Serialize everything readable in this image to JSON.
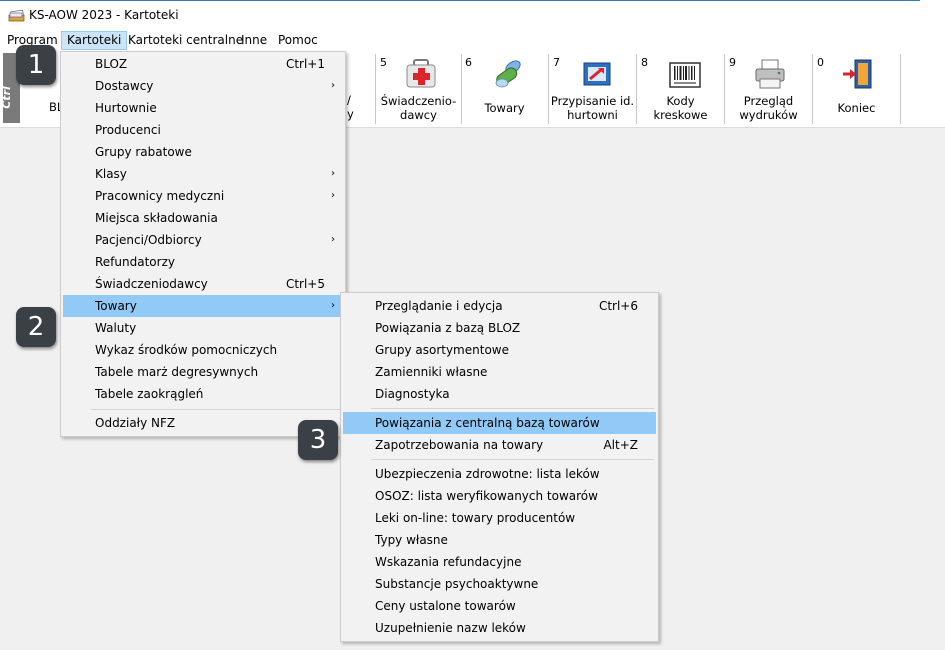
{
  "window": {
    "title": "KS-AOW 2023 - Kartoteki"
  },
  "menubar": {
    "items": [
      "Program",
      "Kartoteki",
      "Kartoteki centralne",
      "Inne",
      "Pomoc"
    ]
  },
  "toolbar": {
    "ctrl_label": "Ctrl",
    "partial_label_1": "BL",
    "partial_label_2": "/",
    "partial_label_3": "y",
    "buttons": [
      {
        "num": "5",
        "label": "Świadczenio-\ndawcy",
        "icon": "medical-kit-icon"
      },
      {
        "num": "6",
        "label": "Towary",
        "icon": "pill-icon"
      },
      {
        "num": "7",
        "label": "Przypisanie id.\nhurtowni",
        "icon": "assign-id-icon"
      },
      {
        "num": "8",
        "label": "Kody\nkreskowe",
        "icon": "barcode-icon"
      },
      {
        "num": "9",
        "label": "Przegląd\nwydruków",
        "icon": "printer-icon"
      },
      {
        "num": "0",
        "label": "Koniec",
        "icon": "exit-door-icon"
      }
    ]
  },
  "kartoteki_menu": {
    "items": [
      {
        "label": "BLOZ",
        "shortcut": "Ctrl+1"
      },
      {
        "label": "Dostawcy",
        "submenu": true
      },
      {
        "label": "Hurtownie"
      },
      {
        "label": "Producenci"
      },
      {
        "label": "Grupy rabatowe"
      },
      {
        "label": "Klasy",
        "submenu": true
      },
      {
        "label": "Pracownicy medyczni",
        "submenu": true
      },
      {
        "label": "Miejsca składowania"
      },
      {
        "label": "Pacjenci/Odbiorcy",
        "submenu": true
      },
      {
        "label": "Refundatorzy"
      },
      {
        "label": "Świadczeniodawcy",
        "shortcut": "Ctrl+5"
      },
      {
        "label": "Towary",
        "submenu": true,
        "highlighted": true
      },
      {
        "label": "Waluty"
      },
      {
        "label": "Wykaz środków pomocniczych"
      },
      {
        "label": "Tabele marż degresywnych"
      },
      {
        "label": "Tabele zaokrągleń"
      },
      {
        "label": "Oddziały NFZ"
      }
    ]
  },
  "towary_submenu": {
    "items": [
      {
        "label": "Przeglądanie i edycja",
        "shortcut": "Ctrl+6"
      },
      {
        "label": "Powiązania z bazą BLOZ"
      },
      {
        "label": "Grupy asortymentowe"
      },
      {
        "label": "Zamienniki własne"
      },
      {
        "label": "Diagnostyka"
      },
      {
        "label": "Powiązania z centralną bazą towarów",
        "highlighted": true
      },
      {
        "label": "Zapotrzebowania na towary",
        "shortcut": "Alt+Z"
      },
      {
        "label": "Ubezpieczenia zdrowotne: lista leków"
      },
      {
        "label": "OSOZ: lista weryfikowanych towarów"
      },
      {
        "label": "Leki on-line: towary producentów"
      },
      {
        "label": "Typy własne"
      },
      {
        "label": "Wskazania refundacyjne"
      },
      {
        "label": "Substancje psychoaktywne"
      },
      {
        "label": "Ceny ustalone towarów"
      },
      {
        "label": "Uzupełnienie nazw leków"
      }
    ]
  },
  "step_badges": [
    "1",
    "2",
    "3"
  ],
  "colors": {
    "highlight": "#91c9f7",
    "menu_active": "#cce4f7",
    "badge": "#3b4047"
  }
}
